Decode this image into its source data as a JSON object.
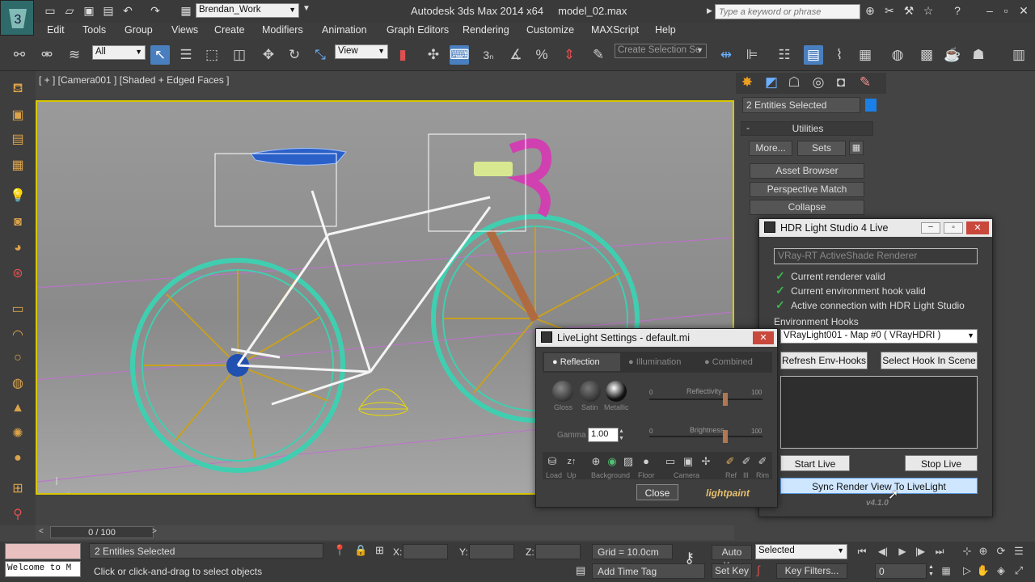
{
  "app": {
    "title": "Autodesk 3ds Max 2014 x64",
    "file": "model_02.max",
    "workspace": "Brendan_Work",
    "search_placeholder": "Type a keyword or phrase"
  },
  "menu": [
    "Edit",
    "Tools",
    "Group",
    "Views",
    "Create",
    "Modifiers",
    "Animation",
    "Graph Editors",
    "Rendering",
    "Customize",
    "MAXScript",
    "Help"
  ],
  "toolbar": {
    "filter_value": "All",
    "coord_value": "View",
    "selection_set_placeholder": "Create Selection Se"
  },
  "viewport": {
    "label": "[ + ] [Camera001 ] [Shaded + Edged Faces ]"
  },
  "command_panel": {
    "selection_status": "2 Entities Selected",
    "section_title": "Utilities",
    "more_label": "More...",
    "sets_label": "Sets",
    "buttons": [
      "Asset Browser",
      "Perspective Match",
      "Collapse"
    ]
  },
  "hdr_window": {
    "title": "HDR Light Studio 4 Live",
    "renderer": "VRay-RT ActiveShade Renderer",
    "status_lines": [
      "Current renderer valid",
      "Current environment hook valid",
      "Active connection with HDR Light Studio"
    ],
    "env_hooks_label": "Environment Hooks",
    "env_hook_value": "VRayLight001 - Map #0  ( VRayHDRI )",
    "refresh_label": "Refresh Env-Hooks",
    "select_hook_label": "Select Hook In Scene",
    "start_label": "Start Live",
    "stop_label": "Stop Live",
    "sync_label": "Sync Render View To LiveLight",
    "version": "v4.1.0"
  },
  "livelight_window": {
    "title": "LiveLight Settings - default.mi",
    "tabs": [
      "Reflection",
      "Illumination",
      "Combined"
    ],
    "materials": [
      "Gloss",
      "Satin",
      "Metallic"
    ],
    "reflectivity_label": "Reflectivity",
    "brightness_label": "Brightness",
    "slider_min": "0",
    "slider_max": "100",
    "gamma_label": "Gamma",
    "gamma_value": "1.00",
    "tool_labels": [
      "Load",
      "Up",
      "Background",
      "Floor",
      "Camera",
      "Ref",
      "Ill",
      "Rim"
    ],
    "close_label": "Close",
    "brand": "lightpaint",
    "reflectivity_level": 0.68,
    "brightness_level": 0.68
  },
  "timeline": {
    "frame": "0 / 100"
  },
  "status": {
    "script_text": "Welcome to M",
    "selection": "2 Entities Selected",
    "prompt": "Click or click-and-drag to select objects",
    "x_label": "X:",
    "y_label": "Y:",
    "z_label": "Z:",
    "grid": "Grid = 10.0cm",
    "add_time_tag": "Add Time Tag",
    "auto_key": "Auto Key",
    "set_key": "Set Key",
    "key_mode_value": "Selected",
    "key_filters": "Key Filters...",
    "frame_field": "0"
  }
}
